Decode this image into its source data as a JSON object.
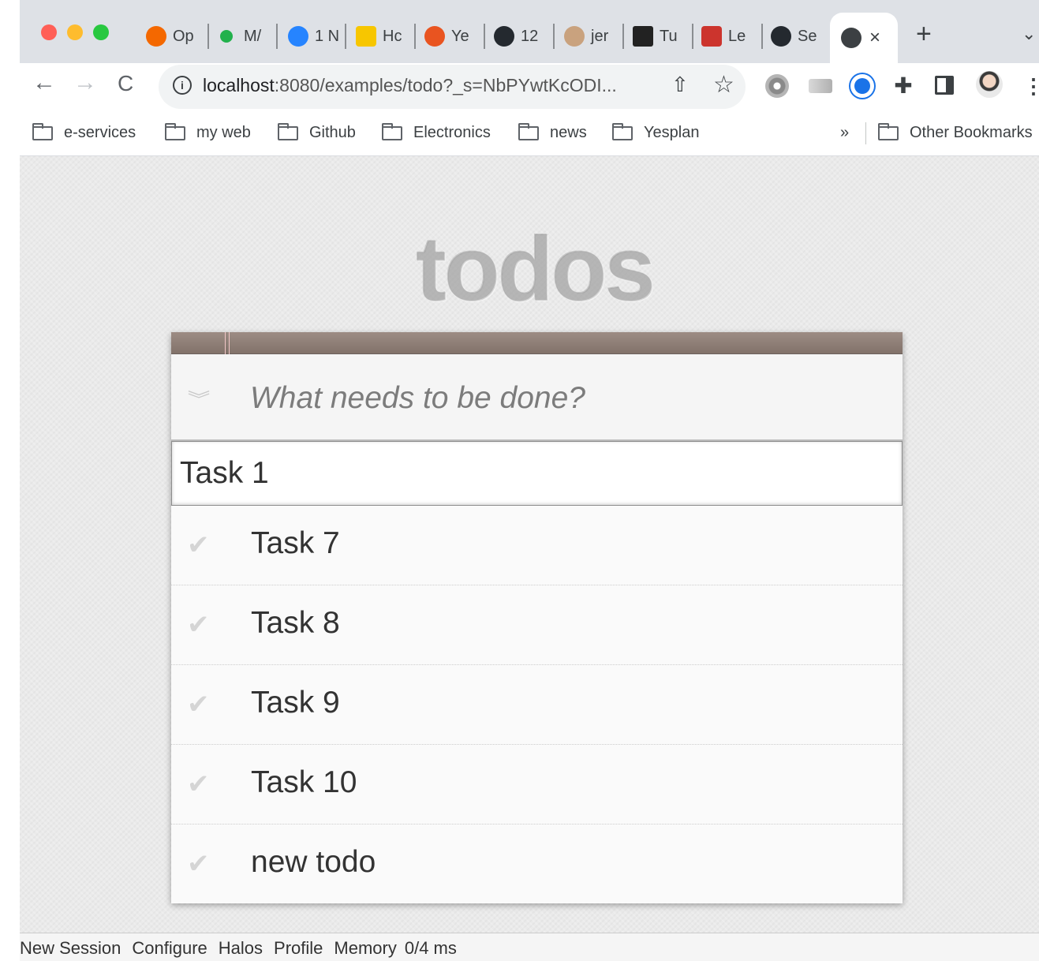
{
  "browser": {
    "tabs": [
      {
        "label": "Op",
        "color": "#f46800"
      },
      {
        "label": "M/",
        "color": "#22b14c"
      },
      {
        "label": "1 N",
        "color": "#2684ff"
      },
      {
        "label": "Hc",
        "color": "#f7c600"
      },
      {
        "label": "Ye",
        "color": "#e95420"
      },
      {
        "label": "12",
        "color": "#24292f"
      },
      {
        "label": "jer",
        "color": "#c9a27e"
      },
      {
        "label": "Tu",
        "color": "#222222"
      },
      {
        "label": "Le",
        "color": "#cc342d"
      },
      {
        "label": "Se",
        "color": "#24292f"
      }
    ],
    "active_tab_close": "×",
    "new_tab": "+",
    "tab_menu": "⌄",
    "nav": {
      "back": "←",
      "forward": "→",
      "reload": "C"
    },
    "address": {
      "host": "localhost",
      "rest": ":8080/examples/todo?_s=NbPYwtKcODI..."
    },
    "bookmarks": [
      "e-services",
      "my web",
      "Github",
      "Electronics",
      "news",
      "Yesplan"
    ],
    "bookmarks_more": "»",
    "other_bookmarks": "Other Bookmarks"
  },
  "app": {
    "title": "todos",
    "new_todo_placeholder": "What needs to be done?",
    "editing_value": "Task 1",
    "todos": [
      "Task 7",
      "Task 8",
      "Task 9",
      "Task 10",
      "new todo"
    ]
  },
  "devbar": {
    "new_session": "New Session",
    "configure": "Configure",
    "halos": "Halos",
    "profile": "Profile",
    "memory": "Memory",
    "timing": "0/4 ms"
  }
}
